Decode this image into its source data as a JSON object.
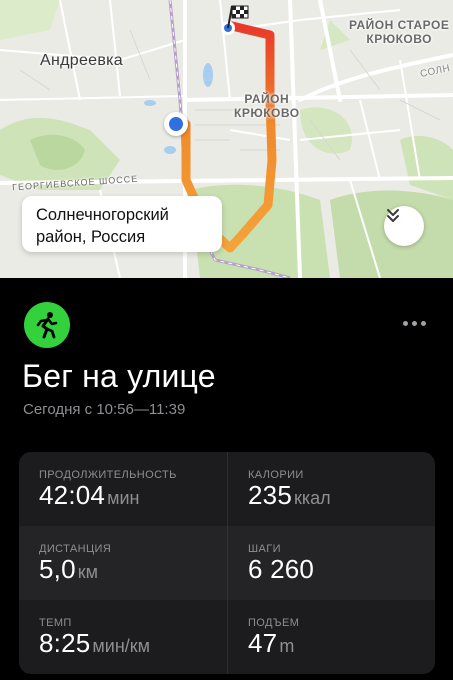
{
  "map": {
    "labels": {
      "andreevka": "Андреевка",
      "staroe_kryukovo_1": "РАЙОН СТАРОЕ",
      "staroe_kryukovo_2": "КРЮКОВО",
      "kryukovo_1": "РАЙОН",
      "kryukovo_2": "КРЮКОВО",
      "soln": "СОЛН",
      "shosse": "ГЕОРГИЕВСКОЕ ШОССЕ"
    },
    "callout_line1": "Солнечногорский",
    "callout_line2": "район, Россия",
    "route_colors": {
      "start": "#f5a33a",
      "mid": "#f08a2a",
      "end": "#e8392a"
    }
  },
  "workout": {
    "icon": "running-figure-icon",
    "accent": "#33d13c",
    "title": "Бег на улице",
    "subtitle": "Сегодня с 10:56—11:39"
  },
  "metrics": [
    {
      "label": "Продолжительность",
      "value": "42:04",
      "unit": "мин"
    },
    {
      "label": "Калории",
      "value": "235",
      "unit": "ккал"
    },
    {
      "label": "Дистанция",
      "value": "5,0",
      "unit": "км"
    },
    {
      "label": "Шаги",
      "value": "6 260",
      "unit": ""
    },
    {
      "label": "Темп",
      "value": "8:25",
      "unit": "мин/км"
    },
    {
      "label": "Подъем",
      "value": "47",
      "unit": "m"
    }
  ]
}
